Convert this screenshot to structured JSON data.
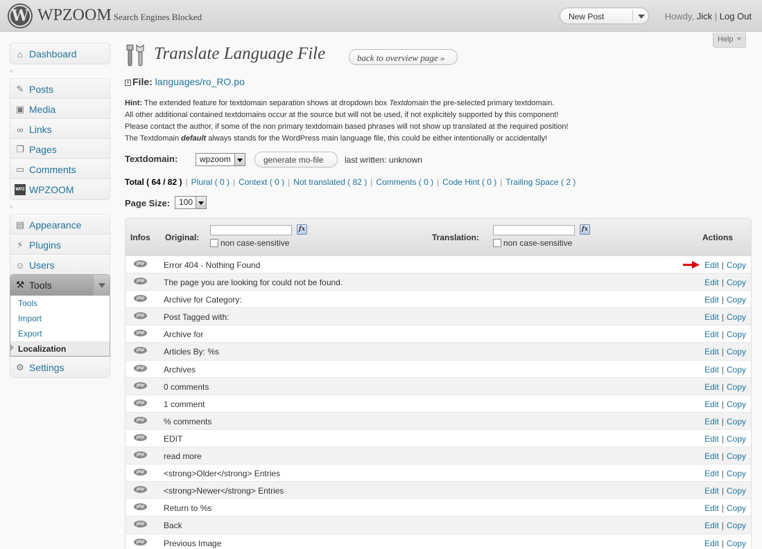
{
  "header": {
    "logo_letter": "W",
    "site_title": "WPZOOM",
    "site_status": "Search Engines Blocked",
    "new_post": "New Post",
    "howdy_prefix": "Howdy,",
    "user": "Jick",
    "separator": "|",
    "logout": "Log Out",
    "help": "Help"
  },
  "sidebar": {
    "group1": [
      {
        "label": "Dashboard",
        "icon": "dashboard-icon"
      }
    ],
    "group2": [
      {
        "label": "Posts",
        "icon": "pushpin-icon"
      },
      {
        "label": "Media",
        "icon": "media-icon"
      },
      {
        "label": "Links",
        "icon": "link-icon"
      },
      {
        "label": "Pages",
        "icon": "pages-icon"
      },
      {
        "label": "Comments",
        "icon": "comments-icon"
      },
      {
        "label": "WPZOOM",
        "icon": "wpzoom-icon"
      }
    ],
    "group3": [
      {
        "label": "Appearance",
        "icon": "appearance-icon"
      },
      {
        "label": "Plugins",
        "icon": "plugins-icon"
      },
      {
        "label": "Users",
        "icon": "users-icon"
      }
    ],
    "tools": {
      "label": "Tools",
      "icon": "tools-icon",
      "submenu": [
        "Tools",
        "Import",
        "Export",
        "Localization"
      ]
    },
    "settings": {
      "label": "Settings",
      "icon": "settings-icon"
    },
    "separator_glyph": "«"
  },
  "main": {
    "title": "Translate Language File",
    "back_button": "back to overview page »",
    "file_label": "File:",
    "file_path": "languages/ro_RO.po",
    "hint_label": "Hint:",
    "hint_lines": {
      "l1a": " The extended feature for textdomain separation shows at dropdown box ",
      "l1b": "Textdomain",
      "l1c": " the pre-selected primary textdomain.",
      "l2": "All other additional contained textdomains occur at the source but will not be used, if not explicitely supported by this component!",
      "l3": "Please contact the author, if some of the non primary textdomain based phrases will not show up translated at the required position!",
      "l4a": "The Textdomain ",
      "l4b": "default",
      "l4c": " always stands for the WordPress main language file, this could be either intentionally or accidentally!"
    },
    "textdomain_label": "Textdomain:",
    "textdomain_value": "wpzoom",
    "generate_button": "generate mo-file",
    "last_written": "last written:  unknown",
    "filters": {
      "total": "Total ( 64 / 82 )",
      "plural": "Plural ( 0 )",
      "context": "Context ( 0 )",
      "not_translated": "Not translated ( 82 )",
      "comments": "Comments ( 0 )",
      "code_hint": "Code Hint ( 0 )",
      "trailing_space": "Trailing Space ( 2 )",
      "pipe": "|"
    },
    "page_size_label": "Page Size:",
    "page_size_value": "100"
  },
  "table": {
    "col_infos": "Infos",
    "col_original": "Original:",
    "col_translation": "Translation:",
    "col_actions": "Actions",
    "fx": "fx",
    "non_case_sensitive": "non case-sensitive",
    "badge": "php",
    "edit": "Edit",
    "copy": "Copy",
    "pipe": "|",
    "rows": [
      "Error 404 - Nothing Found",
      "The page you are looking for could not be found.",
      "Archive for Category:",
      "Post Tagged with:",
      "Archive for",
      "Articles By: %s",
      "Archives",
      "0 comments",
      "1 comment",
      "% comments",
      "EDIT",
      "read more",
      "<strong>Older</strong> Entries",
      "<strong>Newer</strong> Entries",
      "Return to %s",
      "Back",
      "Previous Image"
    ]
  },
  "colors": {
    "link": "#21759b",
    "arrow": "#e00000"
  }
}
